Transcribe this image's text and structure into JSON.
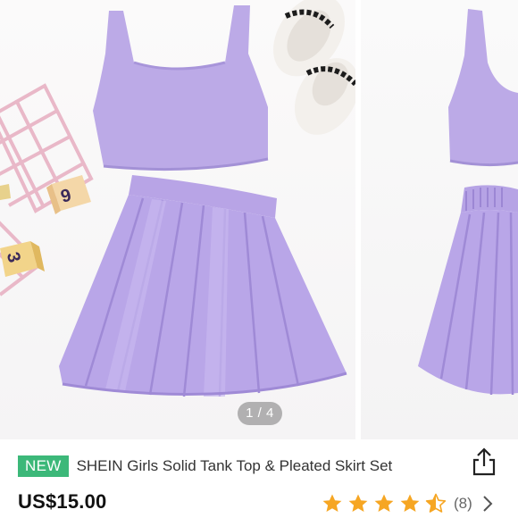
{
  "gallery": {
    "page_indicator": "1 / 4",
    "images": [
      {
        "icon": "lavender-tank-top-pleated-skirt-photo"
      },
      {
        "icon": "lavender-set-next-photo-preview"
      }
    ]
  },
  "product": {
    "badge": "NEW",
    "title": "SHEIN Girls Solid Tank Top & Pleated Skirt Set",
    "price": "US$15.00",
    "rating": 4.5,
    "review_count": "(8)",
    "share_icon": "share-icon",
    "more_icon": "chevron-right-icon"
  },
  "colors": {
    "badge": "#3cb879",
    "star": "#f6a623",
    "garment": "#b9a7e6"
  }
}
